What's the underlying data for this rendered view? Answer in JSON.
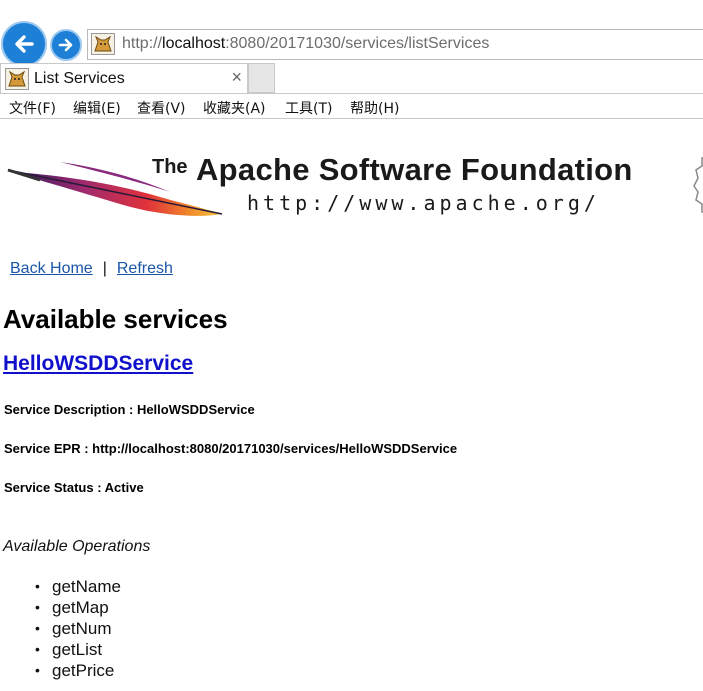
{
  "browser": {
    "address": {
      "prefix": "http://",
      "host": "localhost",
      "path": ":8080/20171030/services/listServices"
    },
    "tab": {
      "title": "List Services",
      "close_glyph": "×"
    },
    "menu": [
      {
        "label": "文件(F)"
      },
      {
        "label": "编辑(E)"
      },
      {
        "label": "查看(V)"
      },
      {
        "label": "收藏夹(A)"
      },
      {
        "label": "工具(T)"
      },
      {
        "label": "帮助(H)"
      }
    ],
    "accent_color": "#1d7fd6"
  },
  "banner": {
    "the": "The",
    "title": "Apache Software Foundation",
    "url": "http://www.apache.org/"
  },
  "nav_links": {
    "back_home": "Back Home",
    "separator": "|",
    "refresh": "Refresh"
  },
  "page": {
    "title": "Available services",
    "service": {
      "name": "HelloWSDDService",
      "description": "Service Description : HelloWSDDService",
      "epr": "Service EPR : http://localhost:8080/20171030/services/HelloWSDDService",
      "status": "Service Status : Active"
    },
    "operations_heading": "Available Operations",
    "operations": [
      "getName",
      "getMap",
      "getNum",
      "getList",
      "getPrice"
    ]
  }
}
